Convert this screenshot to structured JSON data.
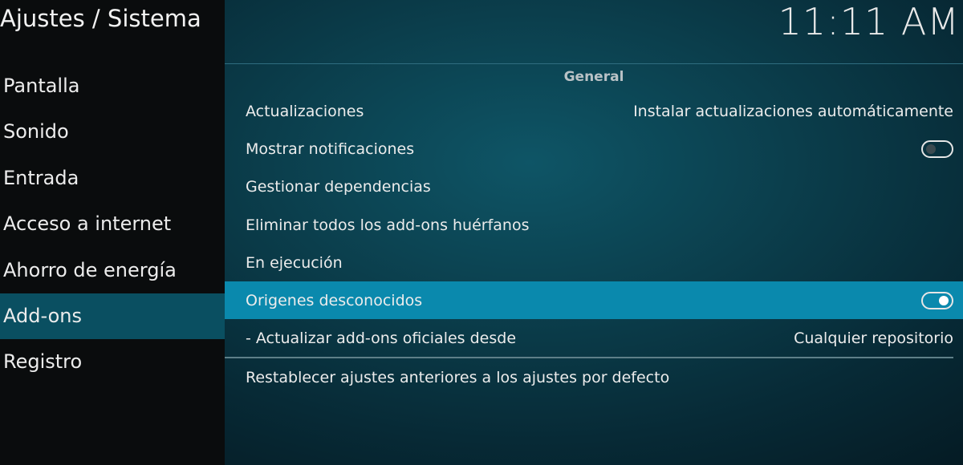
{
  "header": {
    "title": "Ajustes / Sistema",
    "clock": "11:11 AM"
  },
  "sidebar": {
    "items": [
      {
        "label": "Pantalla"
      },
      {
        "label": "Sonido"
      },
      {
        "label": "Entrada"
      },
      {
        "label": "Acceso a internet"
      },
      {
        "label": "Ahorro de energía"
      },
      {
        "label": "Add-ons",
        "active": true
      },
      {
        "label": "Registro"
      }
    ]
  },
  "main": {
    "section_title": "General",
    "settings": [
      {
        "label": "Actualizaciones",
        "value": "Instalar actualizaciones automáticamente"
      },
      {
        "label": "Mostrar notificaciones",
        "toggle": "off"
      },
      {
        "label": "Gestionar dependencias"
      },
      {
        "label": "Eliminar todos los add-ons huérfanos"
      },
      {
        "label": "En ejecución"
      },
      {
        "label": "Origenes desconocidos",
        "toggle": "on",
        "highlighted": true
      },
      {
        "label": "- Actualizar add-ons oficiales desde",
        "value": "Cualquier repositorio"
      }
    ],
    "reset_label": "Restablecer ajustes anteriores a los ajustes por defecto"
  },
  "colors": {
    "sidebar_bg": "#0a0c0d",
    "active_sidebar": "#0a4f61",
    "highlight_row": "#0a89ad"
  }
}
